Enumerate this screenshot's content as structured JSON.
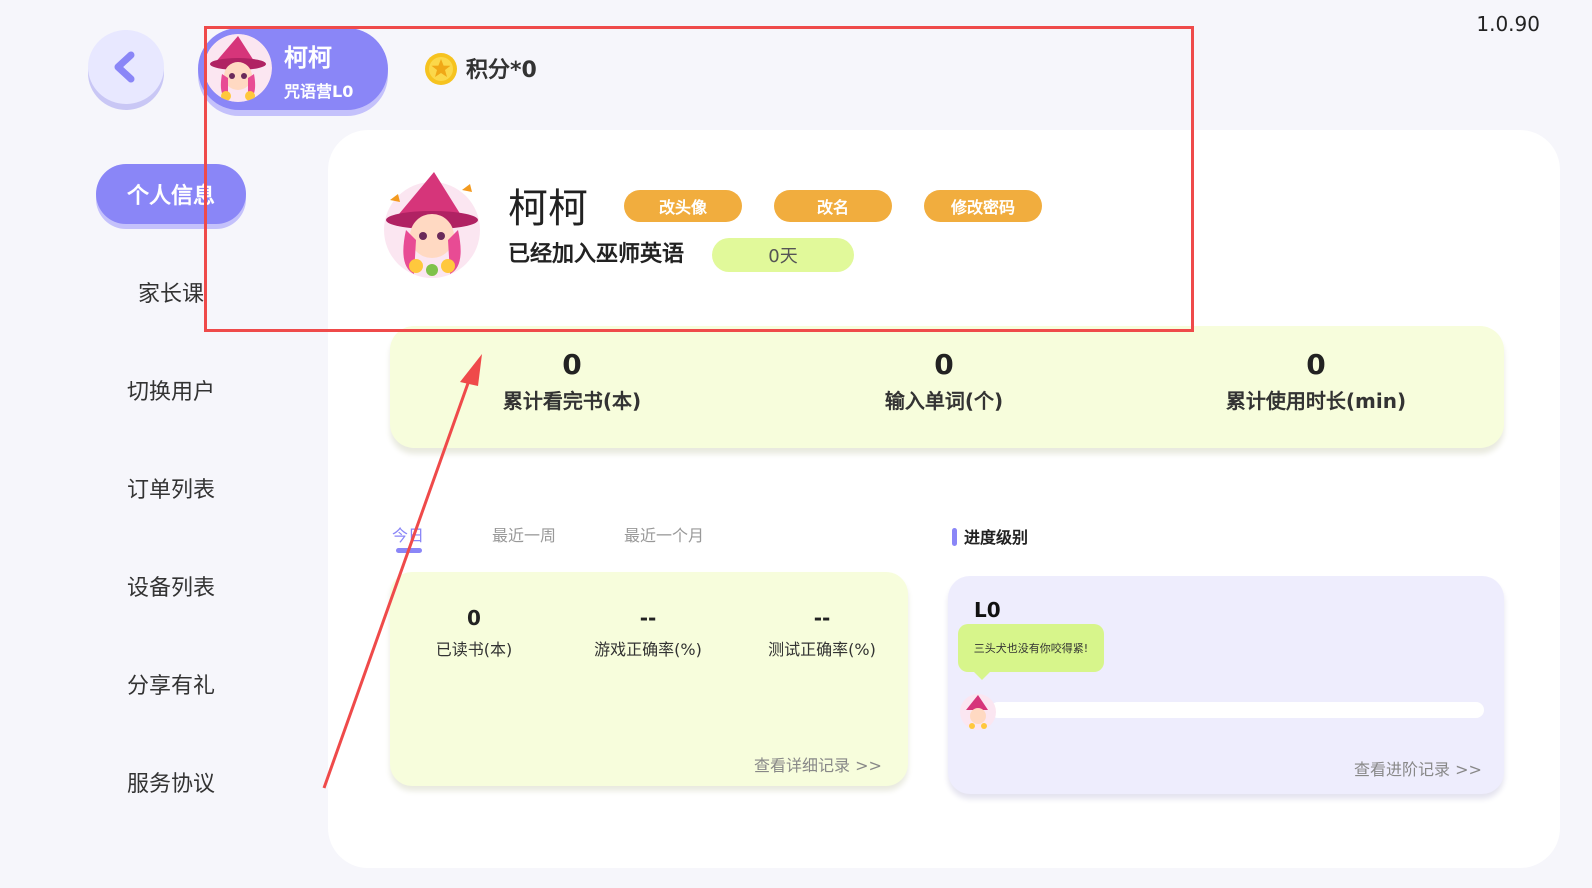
{
  "app": {
    "version": "1.0.90"
  },
  "header": {
    "user_name": "柯柯",
    "user_level": "咒语营L0",
    "points_text": "积分*0"
  },
  "sidebar": {
    "items": [
      {
        "label": "个人信息",
        "active": true
      },
      {
        "label": "家长课"
      },
      {
        "label": "切换用户"
      },
      {
        "label": "订单列表"
      },
      {
        "label": "设备列表"
      },
      {
        "label": "分享有礼"
      },
      {
        "label": "服务协议"
      }
    ]
  },
  "profile": {
    "name": "柯柯",
    "change_avatar": "改头像",
    "rename": "改名",
    "change_password": "修改密码",
    "joined_text": "已经加入巫师英语",
    "days": "0天"
  },
  "stats": [
    {
      "value": "0",
      "label": "累计看完书(本)"
    },
    {
      "value": "0",
      "label": "输入单词(个)"
    },
    {
      "value": "0",
      "label": "累计使用时长(min)"
    }
  ],
  "tabs": [
    {
      "label": "今日",
      "active": true
    },
    {
      "label": "最近一周"
    },
    {
      "label": "最近一个月"
    }
  ],
  "today": {
    "items": [
      {
        "value": "0",
        "label": "已读书(本)"
      },
      {
        "value": "--",
        "label": "游戏正确率(%)"
      },
      {
        "value": "--",
        "label": "测试正确率(%)"
      }
    ],
    "detail_link": "查看详细记录 >>"
  },
  "progress": {
    "title": "进度级别",
    "level": "L0",
    "bubble": "三头犬也没有你咬得紧!",
    "link": "查看进阶记录 >>"
  },
  "colors": {
    "accent": "#8a86f7",
    "orange": "#f1ad3e",
    "lime": "#e1f99a",
    "annotation": "#ef4a4a"
  }
}
